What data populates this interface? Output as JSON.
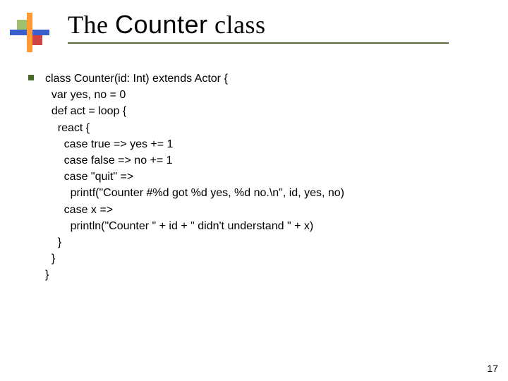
{
  "title": {
    "part1": "The ",
    "part2": "Counter",
    "part3": " class"
  },
  "code": {
    "l1": "class Counter(id: Int) extends Actor {",
    "l2": "  var yes, no = 0",
    "l3": "  def act = loop {",
    "l4": "    react {",
    "l5": "      case true => yes += 1",
    "l6": "      case false => no += 1",
    "l7": "      case \"quit\" =>",
    "l8": "        printf(\"Counter #%d got %d yes, %d no.\\n\", id, yes, no)",
    "l9": "      case x =>",
    "l10": "        println(\"Counter \" + id + \" didn't understand \" + x)",
    "l11": "    }",
    "l12": "  }",
    "l13": "}"
  },
  "page_number": "17",
  "colors": {
    "underline": "#5a6b3a",
    "bullet": "#4a6a2a",
    "logo_blue": "#3a5fcd",
    "logo_orange": "#ff9933",
    "logo_green": "#a0c070",
    "logo_red": "#cc4444"
  }
}
